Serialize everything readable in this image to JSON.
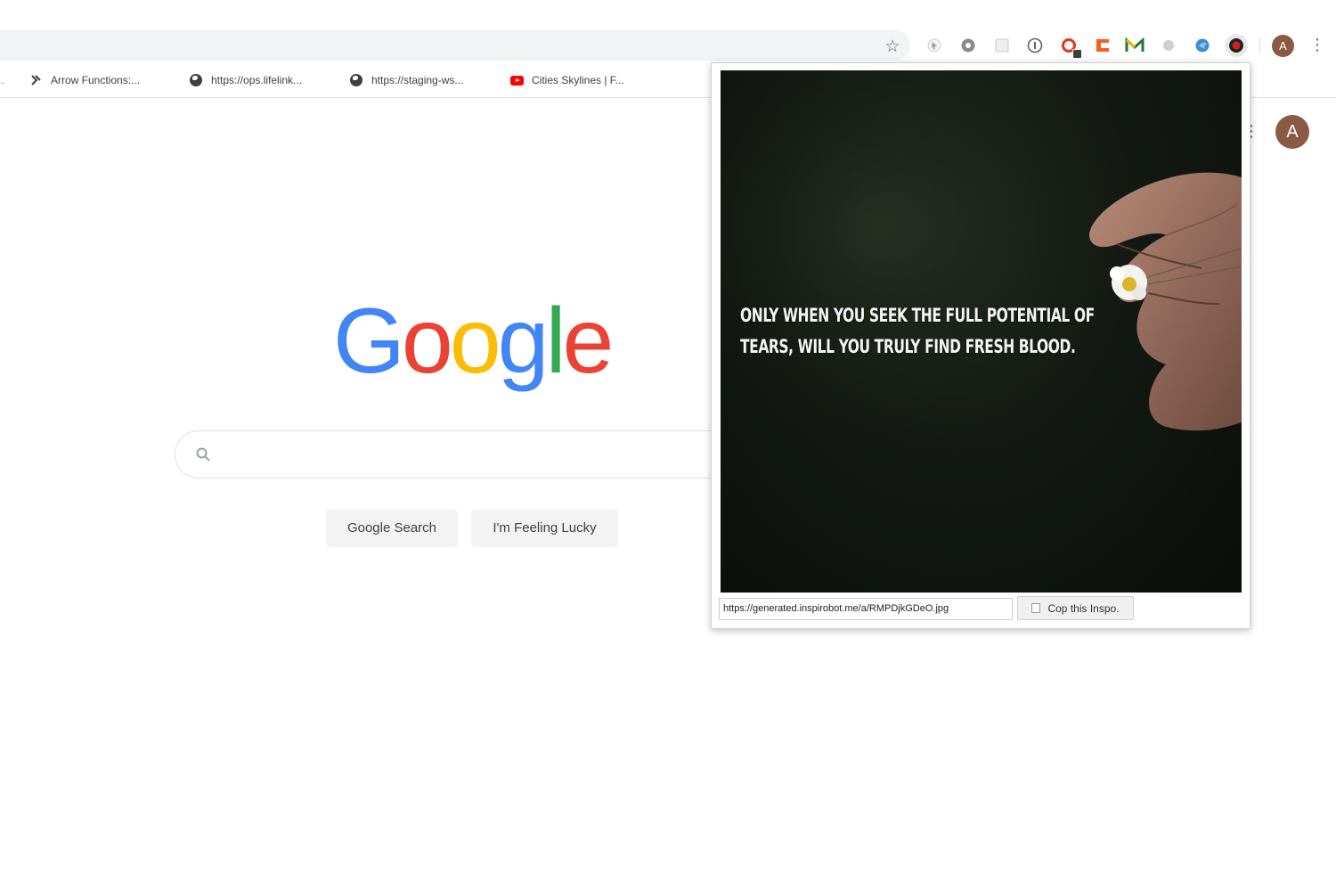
{
  "toolbar": {
    "bookmark_star": "☆",
    "extensions": [
      {
        "name": "extension-icon-1",
        "color": "#c8c8c8"
      },
      {
        "name": "extension-icon-2",
        "color": "#8a8a8a"
      },
      {
        "name": "extension-icon-3",
        "color": "#d6d6d6"
      },
      {
        "name": "extension-icon-4",
        "color": "#5f6368"
      },
      {
        "name": "extension-icon-5",
        "color": "#e8331c"
      },
      {
        "name": "extension-icon-6",
        "color": "#ff5a1f"
      },
      {
        "name": "extension-icon-7",
        "color": "#1f7a3d"
      },
      {
        "name": "extension-icon-8",
        "color": "#bdbdbd"
      },
      {
        "name": "extension-icon-9",
        "color": "#3b8fd9"
      },
      {
        "name": "extension-icon-10",
        "color": "#d11f1f"
      }
    ],
    "profile_initial": "A",
    "menu": "⋮"
  },
  "bookmarks": [
    {
      "label": "Arrow Functions:...",
      "icon": "arrow-icon"
    },
    {
      "label": "https://ops.lifelink...",
      "icon": "globe-icon"
    },
    {
      "label": "https://staging-ws...",
      "icon": "globe-icon"
    },
    {
      "label": "Cities Skylines | F...",
      "icon": "youtube-icon"
    }
  ],
  "google": {
    "logo_letters": [
      "G",
      "o",
      "o",
      "g",
      "l",
      "e"
    ],
    "logo_colors": [
      "#4285f4",
      "#ea4335",
      "#fbbc05",
      "#4285f4",
      "#34a853",
      "#ea4335"
    ],
    "search_value": "",
    "search_button": "Google Search",
    "lucky_button": "I'm Feeling Lucky",
    "apps_icon": "⋮",
    "avatar_initial": "A"
  },
  "popup": {
    "quote": "Only when you seek the full potential of tears, will you truly find fresh blood.",
    "image_url": "https://generated.inspirobot.me/a/RMPDjkGDeO.jpg",
    "copy_label": "Cop this Inspo."
  }
}
